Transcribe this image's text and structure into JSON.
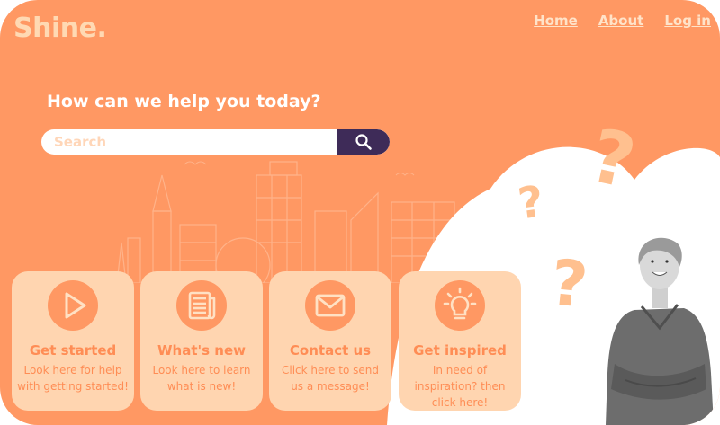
{
  "brand": {
    "logo": "Shine."
  },
  "nav": {
    "items": [
      "Home",
      "About",
      "Log in"
    ]
  },
  "hero": {
    "headline": "How can we help you today?",
    "search_placeholder": "Search",
    "search_value": ""
  },
  "decorations": {
    "question_mark": "?"
  },
  "cards": [
    {
      "title": "Get started",
      "desc": "Look here for help with getting started!",
      "icon": "play-icon"
    },
    {
      "title": "What's new",
      "desc": "Look here to learn what is new!",
      "icon": "newspaper-icon"
    },
    {
      "title": "Contact us",
      "desc": "Click here to send us a message!",
      "icon": "envelope-icon"
    },
    {
      "title": "Get inspired",
      "desc": "In need of inspiration? then click here!",
      "icon": "lightbulb-icon"
    }
  ],
  "colors": {
    "background": "#ff9863",
    "card": "#ffd5b0",
    "accent_text": "#ff8d55",
    "search_button": "#3e2b58",
    "question_marks": "#ffc08f"
  }
}
